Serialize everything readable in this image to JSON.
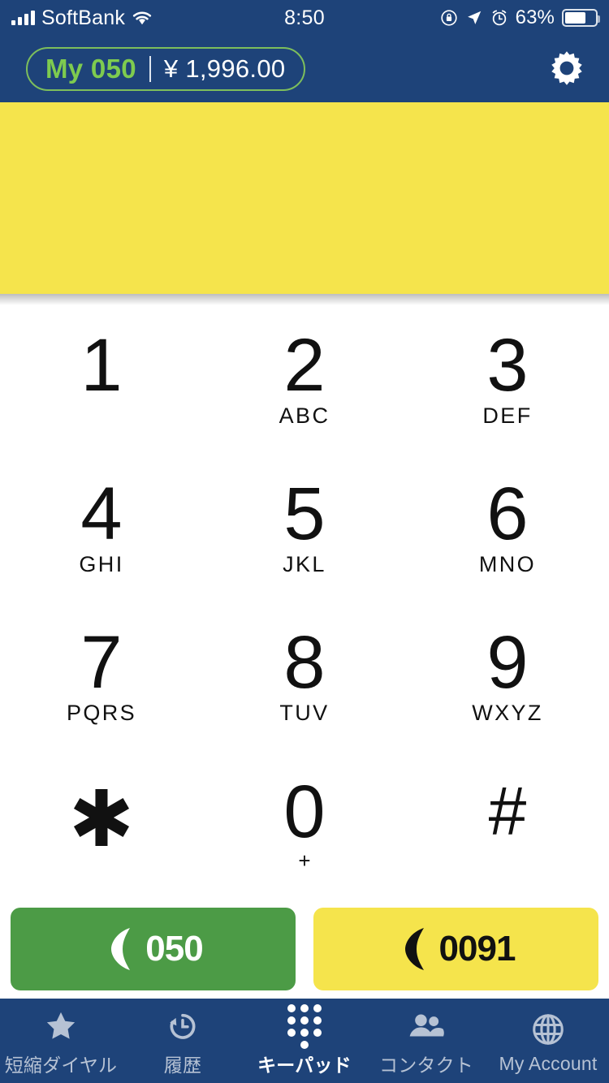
{
  "status_bar": {
    "carrier": "SoftBank",
    "time": "8:50",
    "battery_percent": "63%",
    "icons": [
      "signal-bars-icon",
      "wifi-icon",
      "rotation-lock-icon",
      "location-arrow-icon",
      "alarm-clock-icon",
      "battery-icon"
    ]
  },
  "header": {
    "balance_label": "My 050",
    "balance_amount": "¥ 1,996.00",
    "settings_icon": "gear-icon",
    "colors": {
      "bar": "#1E4379",
      "pill_border": "#7DBE5C",
      "label_text": "#7ECB4F",
      "amount_text": "#FFFFFF"
    }
  },
  "banner": {
    "content": "",
    "color": "#F5E44C"
  },
  "keypad": {
    "keys": [
      {
        "digit": "1",
        "sub": ""
      },
      {
        "digit": "2",
        "sub": "ABC"
      },
      {
        "digit": "3",
        "sub": "DEF"
      },
      {
        "digit": "4",
        "sub": "GHI"
      },
      {
        "digit": "5",
        "sub": "JKL"
      },
      {
        "digit": "6",
        "sub": "MNO"
      },
      {
        "digit": "7",
        "sub": "PQRS"
      },
      {
        "digit": "8",
        "sub": "TUV"
      },
      {
        "digit": "9",
        "sub": "WXYZ"
      },
      {
        "digit": "✱",
        "sub": ""
      },
      {
        "digit": "0",
        "sub": "+"
      },
      {
        "digit": "#",
        "sub": ""
      }
    ]
  },
  "call_buttons": [
    {
      "label": "050",
      "icon": "phone-handset-icon",
      "bg": "#4C9B46",
      "fg": "#FFFFFF"
    },
    {
      "label": "0091",
      "icon": "phone-handset-icon",
      "bg": "#F5E44C",
      "fg": "#111111"
    }
  ],
  "tab_bar": {
    "items": [
      {
        "label": "短縮ダイヤル",
        "icon": "star-icon",
        "active": false
      },
      {
        "label": "履歴",
        "icon": "history-clock-icon",
        "active": false
      },
      {
        "label": "キーパッド",
        "icon": "keypad-dots-icon",
        "active": true
      },
      {
        "label": "コンタクト",
        "icon": "people-icon",
        "active": false
      },
      {
        "label": "My Account",
        "icon": "globe-icon",
        "active": false
      }
    ],
    "colors": {
      "bar": "#1E4379",
      "inactive": "#B6C2D4",
      "active": "#FFFFFF"
    }
  }
}
